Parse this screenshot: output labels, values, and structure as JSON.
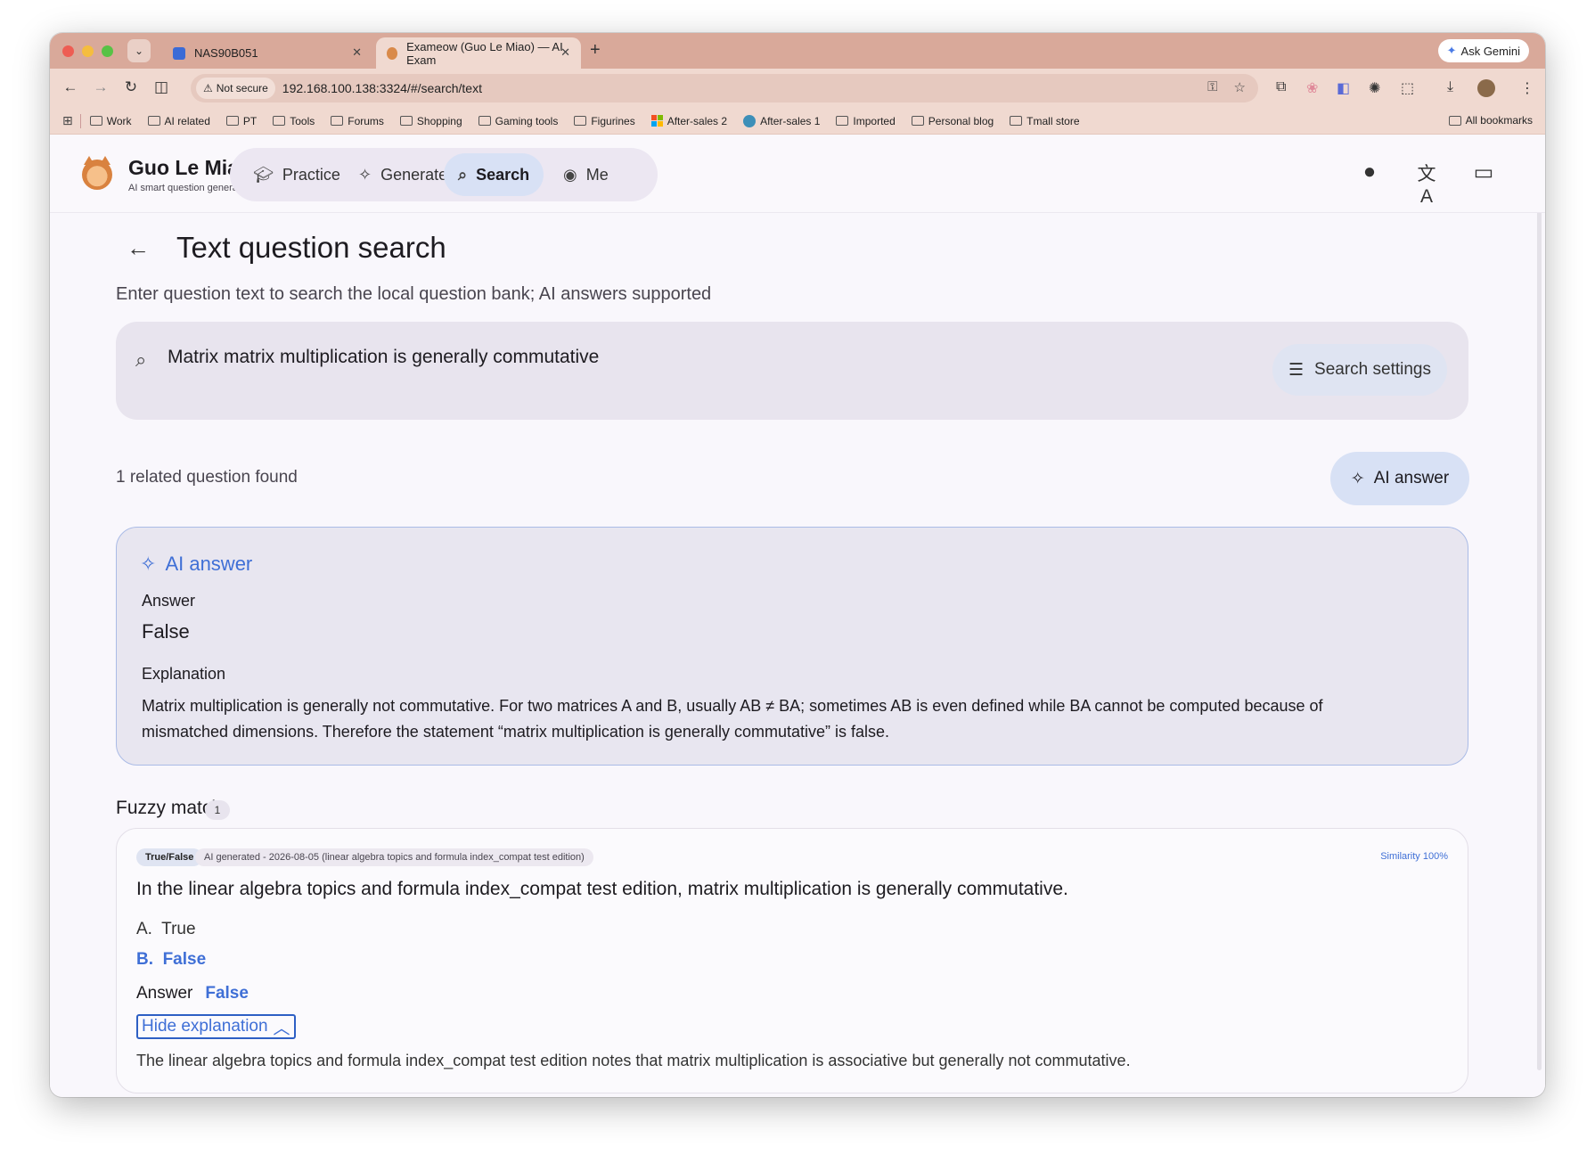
{
  "browser": {
    "tabs": [
      {
        "title": "NAS90B051"
      },
      {
        "title": "Exameow (Guo Le Miao) — AI Exam"
      }
    ],
    "gemini_label": "Ask Gemini",
    "insecure_label": "Not secure",
    "url": "192.168.100.138:3324/#/search/text",
    "bookmarks": [
      "Work",
      "AI related",
      "PT",
      "Tools",
      "Forums",
      "Shopping",
      "Gaming tools",
      "Figurines",
      "After-sales 2",
      "After-sales 1",
      "Imported",
      "Personal blog",
      "Tmall store"
    ],
    "all_bookmarks": "All bookmarks"
  },
  "app": {
    "brand_name": "Guo Le Miao",
    "brand_sub": "AI smart question generation",
    "nav": [
      {
        "label": "Practice",
        "icon": "graduation-cap-icon"
      },
      {
        "label": "Generate",
        "icon": "sparkles-icon"
      },
      {
        "label": "Search",
        "icon": "search-icon",
        "active": true
      },
      {
        "label": "Me",
        "icon": "user-circle-icon"
      }
    ]
  },
  "page": {
    "title": "Text question search",
    "subtitle": "Enter question text to search the local question bank; AI answers supported",
    "search_value": "Matrix matrix multiplication is generally commutative",
    "search_settings": "Search settings",
    "found_text": "1 related question found",
    "ai_answer_button": "AI answer"
  },
  "ai_card": {
    "title": "AI answer",
    "answer_label": "Answer",
    "answer_value": "False",
    "explain_label": "Explanation",
    "explain_text": "Matrix multiplication is generally not commutative. For two matrices A and B, usually AB ≠ BA; sometimes AB is even defined while BA cannot be computed because of mismatched dimensions. Therefore the statement “matrix multiplication is generally commutative” is false."
  },
  "fuzzy": {
    "title": "Fuzzy match",
    "count": "1",
    "items": [
      {
        "type_tag": "True/False",
        "source_tag": "AI generated - 2026-08-05 (linear algebra topics and formula index_compat test edition)",
        "similarity": "Similarity 100%",
        "question": "In the linear algebra topics and formula index_compat test edition, matrix multiplication is generally commutative.",
        "options": [
          {
            "key": "A.",
            "text": "True",
            "correct": false
          },
          {
            "key": "B.",
            "text": "False",
            "correct": true
          }
        ],
        "answer_label": "Answer",
        "answer_value": "False",
        "collapse_label": "Hide explanation",
        "explanation": "The linear algebra topics and formula index_compat test edition notes that matrix multiplication is associative but generally not commutative."
      }
    ]
  }
}
